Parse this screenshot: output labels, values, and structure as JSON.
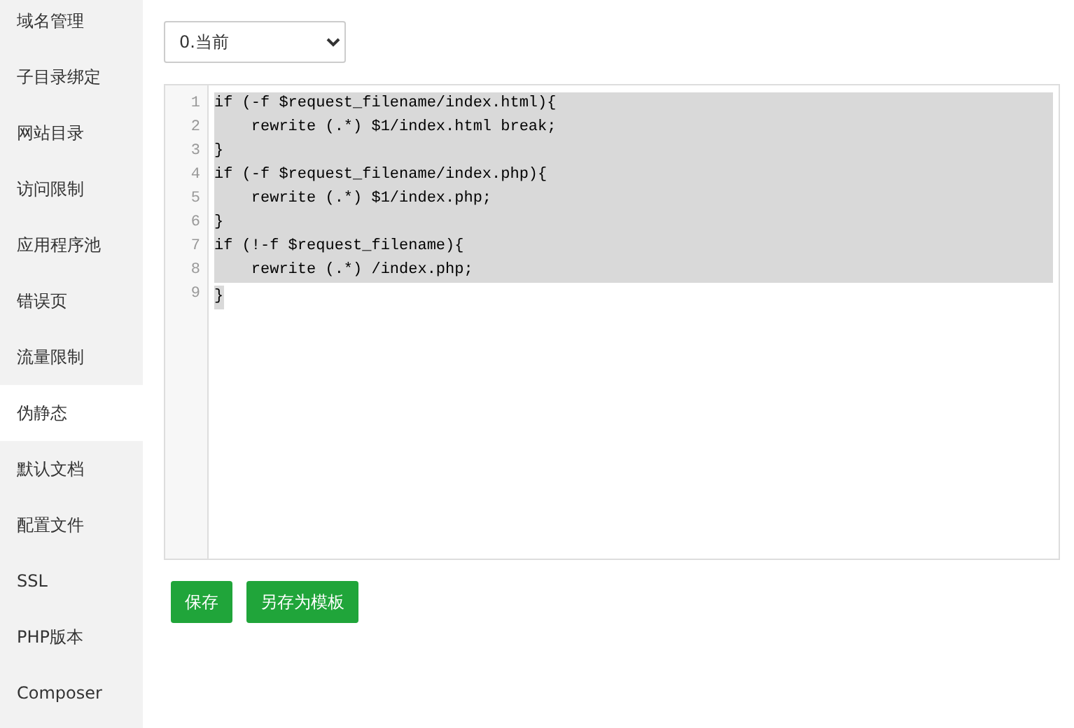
{
  "sidebar": {
    "items": [
      {
        "label": "域名管理",
        "selected": false
      },
      {
        "label": "子目录绑定",
        "selected": false
      },
      {
        "label": "网站目录",
        "selected": false
      },
      {
        "label": "访问限制",
        "selected": false
      },
      {
        "label": "应用程序池",
        "selected": false
      },
      {
        "label": "错误页",
        "selected": false
      },
      {
        "label": "流量限制",
        "selected": false
      },
      {
        "label": "伪静态",
        "selected": true
      },
      {
        "label": "默认文档",
        "selected": false
      },
      {
        "label": "配置文件",
        "selected": false
      },
      {
        "label": "SSL",
        "selected": false
      },
      {
        "label": "PHP版本",
        "selected": false
      },
      {
        "label": "Composer",
        "selected": false
      }
    ]
  },
  "version_select": {
    "value": "0.当前"
  },
  "editor": {
    "lines": [
      {
        "number": "1",
        "code": "if (-f $request_filename/index.html){",
        "selected": true
      },
      {
        "number": "2",
        "code": "    rewrite (.*) $1/index.html break;",
        "selected": true
      },
      {
        "number": "3",
        "code": "}",
        "selected": true
      },
      {
        "number": "4",
        "code": "if (-f $request_filename/index.php){",
        "selected": true
      },
      {
        "number": "5",
        "code": "    rewrite (.*) $1/index.php;",
        "selected": true
      },
      {
        "number": "6",
        "code": "}",
        "selected": true
      },
      {
        "number": "7",
        "code": "if (!-f $request_filename){",
        "selected": true
      },
      {
        "number": "8",
        "code": "    rewrite (.*) /index.php;",
        "selected": true
      },
      {
        "number": "9",
        "code": "}",
        "selected": true
      }
    ]
  },
  "buttons": [
    "保存",
    "另存为模板"
  ]
}
